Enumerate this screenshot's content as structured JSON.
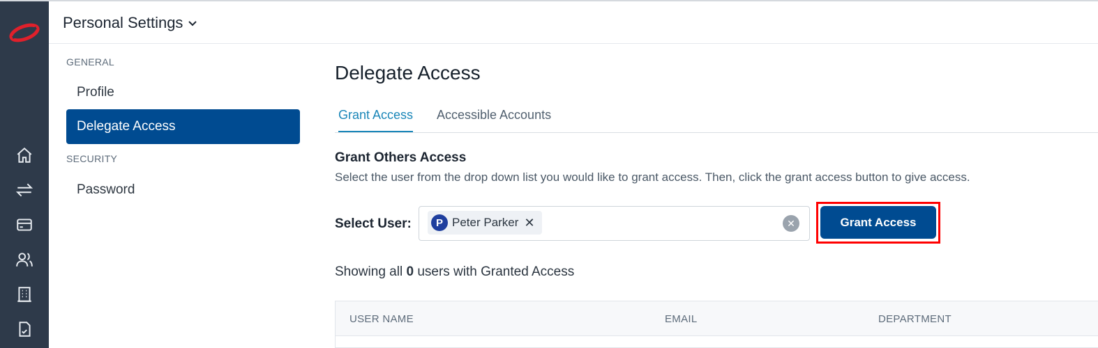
{
  "app": {
    "header_title": "Personal Settings"
  },
  "rail": {
    "icons": [
      "home-icon",
      "transfer-icon",
      "card-icon",
      "users-icon",
      "building-icon",
      "receipt-icon"
    ]
  },
  "subnav": {
    "general_label": "GENERAL",
    "profile_label": "Profile",
    "delegate_label": "Delegate Access",
    "security_label": "SECURITY",
    "password_label": "Password"
  },
  "main": {
    "title": "Delegate Access",
    "tabs": [
      {
        "label": "Grant Access",
        "active": true
      },
      {
        "label": "Accessible Accounts",
        "active": false
      }
    ],
    "section_title": "Grant Others Access",
    "section_desc": "Select the user from the drop down list you would like to grant access. Then, click the grant access button to give access.",
    "select_label": "Select User:",
    "selected_user": {
      "initial": "P",
      "name": "Peter Parker"
    },
    "grant_button": "Grant Access",
    "showing_prefix": "Showing all",
    "showing_count": "0",
    "showing_suffix": "users with Granted Access",
    "table_headers": [
      "USER NAME",
      "EMAIL",
      "DEPARTMENT"
    ]
  },
  "colors": {
    "rail_bg": "#2e3a4a",
    "brand_red": "#e0202b",
    "primary": "#004b91",
    "tab_active": "#1a86b8",
    "highlight": "#ff0000"
  }
}
